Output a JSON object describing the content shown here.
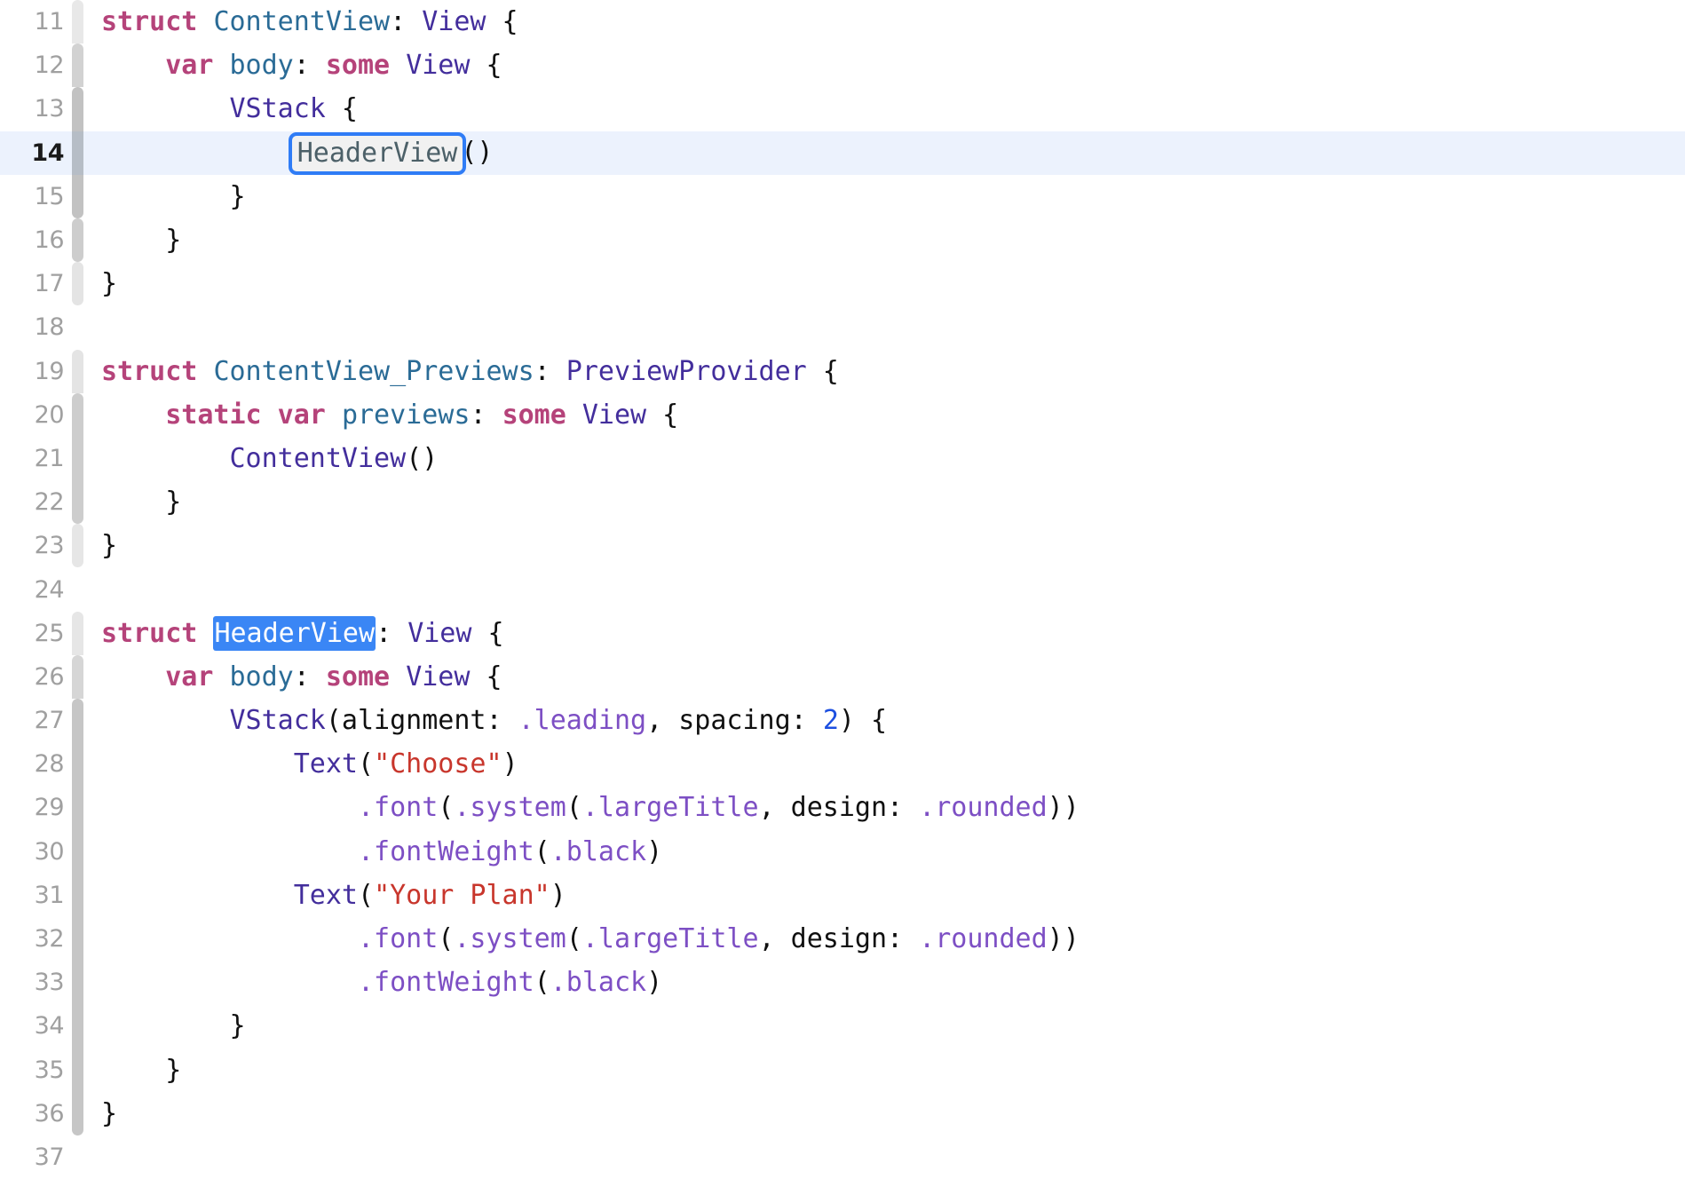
{
  "editor": {
    "name": "code-editor",
    "language": "Swift",
    "current_line": 14,
    "colors": {
      "background": "#ffffff",
      "current_line_highlight": "#ecf2fd",
      "gutter_text": "#a0a0a0",
      "gutter_text_current": "#1a1a1a",
      "keyword": "#b5437a",
      "type": "#2a6b96",
      "protocol": "#432e9c",
      "member": "#7d4fc4",
      "string": "#c8362c",
      "number": "#1c4fe0",
      "plain": "#101010",
      "selection_background": "#3a86f5",
      "selection_text": "#ffffff",
      "rename_box_border": "#2f7cf6",
      "rename_box_fill": "#f1f1f1",
      "rename_box_text": "#4c6068"
    },
    "lines": [
      {
        "number": "11",
        "changebar": "#e8e8e8",
        "shape": "top",
        "tokens": [
          {
            "t": "struct ",
            "c": "kw"
          },
          {
            "t": "ContentView",
            "c": "type"
          },
          {
            "t": ": ",
            "c": "plain"
          },
          {
            "t": "View",
            "c": "proto"
          },
          {
            "t": " {",
            "c": "plain"
          }
        ]
      },
      {
        "number": "12",
        "changebar": "#d2d2d2",
        "shape": "top",
        "tokens": [
          {
            "t": "    ",
            "c": "plain"
          },
          {
            "t": "var ",
            "c": "kw"
          },
          {
            "t": "body",
            "c": "type"
          },
          {
            "t": ": ",
            "c": "plain"
          },
          {
            "t": "some ",
            "c": "kw"
          },
          {
            "t": "View",
            "c": "proto"
          },
          {
            "t": " {",
            "c": "plain"
          }
        ]
      },
      {
        "number": "13",
        "changebar": "#c2c2c2",
        "shape": "top",
        "tokens": [
          {
            "t": "        ",
            "c": "plain"
          },
          {
            "t": "VStack",
            "c": "ctor"
          },
          {
            "t": " {",
            "c": "plain"
          }
        ]
      },
      {
        "number": "14",
        "changebar": "#b6bdc6",
        "shape": "none",
        "current": true,
        "tokens": [
          {
            "t": "            ",
            "c": "plain"
          },
          {
            "t": "HeaderView",
            "c": "rename"
          },
          {
            "t": "()",
            "c": "plain"
          }
        ]
      },
      {
        "number": "15",
        "changebar": "#c2c2c2",
        "shape": "bottom",
        "tokens": [
          {
            "t": "        }",
            "c": "plain"
          }
        ]
      },
      {
        "number": "16",
        "changebar": "#cdcdcd",
        "shape": "both",
        "tokens": [
          {
            "t": "    }",
            "c": "plain"
          }
        ]
      },
      {
        "number": "17",
        "changebar": "#e4e4e4",
        "shape": "both",
        "tokens": [
          {
            "t": "}",
            "c": "plain"
          }
        ]
      },
      {
        "number": "18",
        "changebar": "",
        "shape": "none",
        "tokens": []
      },
      {
        "number": "19",
        "changebar": "#e4e4e4",
        "shape": "top",
        "tokens": [
          {
            "t": "struct ",
            "c": "kw"
          },
          {
            "t": "ContentView_Previews",
            "c": "type"
          },
          {
            "t": ": ",
            "c": "plain"
          },
          {
            "t": "PreviewProvider",
            "c": "proto"
          },
          {
            "t": " {",
            "c": "plain"
          }
        ]
      },
      {
        "number": "20",
        "changebar": "#cdcdcd",
        "shape": "top",
        "tokens": [
          {
            "t": "    ",
            "c": "plain"
          },
          {
            "t": "static var ",
            "c": "kw"
          },
          {
            "t": "previews",
            "c": "type"
          },
          {
            "t": ": ",
            "c": "plain"
          },
          {
            "t": "some ",
            "c": "kw"
          },
          {
            "t": "View",
            "c": "proto"
          },
          {
            "t": " {",
            "c": "plain"
          }
        ]
      },
      {
        "number": "21",
        "changebar": "#cdcdcd",
        "shape": "none",
        "tokens": [
          {
            "t": "        ",
            "c": "plain"
          },
          {
            "t": "ContentView",
            "c": "ctor"
          },
          {
            "t": "()",
            "c": "plain"
          }
        ]
      },
      {
        "number": "22",
        "changebar": "#cdcdcd",
        "shape": "bottom",
        "tokens": [
          {
            "t": "    }",
            "c": "plain"
          }
        ]
      },
      {
        "number": "23",
        "changebar": "#e6e6e6",
        "shape": "both",
        "tokens": [
          {
            "t": "}",
            "c": "plain"
          }
        ]
      },
      {
        "number": "24",
        "changebar": "",
        "shape": "none",
        "tokens": []
      },
      {
        "number": "25",
        "changebar": "#e6e6e6",
        "shape": "top",
        "tokens": [
          {
            "t": "struct ",
            "c": "kw"
          },
          {
            "t": "HeaderView",
            "c": "selected"
          },
          {
            "t": ": ",
            "c": "plain"
          },
          {
            "t": "View",
            "c": "proto"
          },
          {
            "t": " {",
            "c": "plain"
          }
        ]
      },
      {
        "number": "26",
        "changebar": "#d6d6d6",
        "shape": "top",
        "tokens": [
          {
            "t": "    ",
            "c": "plain"
          },
          {
            "t": "var ",
            "c": "kw"
          },
          {
            "t": "body",
            "c": "type"
          },
          {
            "t": ": ",
            "c": "plain"
          },
          {
            "t": "some ",
            "c": "kw"
          },
          {
            "t": "View",
            "c": "proto"
          },
          {
            "t": " {",
            "c": "plain"
          }
        ]
      },
      {
        "number": "27",
        "changebar": "#c6c6c6",
        "shape": "top",
        "tokens": [
          {
            "t": "        ",
            "c": "plain"
          },
          {
            "t": "VStack",
            "c": "ctor"
          },
          {
            "t": "(alignment: ",
            "c": "plain"
          },
          {
            "t": ".leading",
            "c": "member"
          },
          {
            "t": ", spacing: ",
            "c": "plain"
          },
          {
            "t": "2",
            "c": "num"
          },
          {
            "t": ") {",
            "c": "plain"
          }
        ]
      },
      {
        "number": "28",
        "changebar": "#c6c6c6",
        "shape": "none",
        "tokens": [
          {
            "t": "            ",
            "c": "plain"
          },
          {
            "t": "Text",
            "c": "ctor"
          },
          {
            "t": "(",
            "c": "plain"
          },
          {
            "t": "\"Choose\"",
            "c": "str"
          },
          {
            "t": ")",
            "c": "plain"
          }
        ]
      },
      {
        "number": "29",
        "changebar": "#c6c6c6",
        "shape": "none",
        "tokens": [
          {
            "t": "                ",
            "c": "plain"
          },
          {
            "t": ".font",
            "c": "member"
          },
          {
            "t": "(",
            "c": "plain"
          },
          {
            "t": ".system",
            "c": "member"
          },
          {
            "t": "(",
            "c": "plain"
          },
          {
            "t": ".largeTitle",
            "c": "member"
          },
          {
            "t": ", design: ",
            "c": "plain"
          },
          {
            "t": ".rounded",
            "c": "member"
          },
          {
            "t": "))",
            "c": "plain"
          }
        ]
      },
      {
        "number": "30",
        "changebar": "#c6c6c6",
        "shape": "none",
        "tokens": [
          {
            "t": "                ",
            "c": "plain"
          },
          {
            "t": ".fontWeight",
            "c": "member"
          },
          {
            "t": "(",
            "c": "plain"
          },
          {
            "t": ".black",
            "c": "member"
          },
          {
            "t": ")",
            "c": "plain"
          }
        ]
      },
      {
        "number": "31",
        "changebar": "#c6c6c6",
        "shape": "none",
        "tokens": [
          {
            "t": "            ",
            "c": "plain"
          },
          {
            "t": "Text",
            "c": "ctor"
          },
          {
            "t": "(",
            "c": "plain"
          },
          {
            "t": "\"Your Plan\"",
            "c": "str"
          },
          {
            "t": ")",
            "c": "plain"
          }
        ]
      },
      {
        "number": "32",
        "changebar": "#c6c6c6",
        "shape": "none",
        "tokens": [
          {
            "t": "                ",
            "c": "plain"
          },
          {
            "t": ".font",
            "c": "member"
          },
          {
            "t": "(",
            "c": "plain"
          },
          {
            "t": ".system",
            "c": "member"
          },
          {
            "t": "(",
            "c": "plain"
          },
          {
            "t": ".largeTitle",
            "c": "member"
          },
          {
            "t": ", design: ",
            "c": "plain"
          },
          {
            "t": ".rounded",
            "c": "member"
          },
          {
            "t": "))",
            "c": "plain"
          }
        ]
      },
      {
        "number": "33",
        "changebar": "#c6c6c6",
        "shape": "none",
        "tokens": [
          {
            "t": "                ",
            "c": "plain"
          },
          {
            "t": ".fontWeight",
            "c": "member"
          },
          {
            "t": "(",
            "c": "plain"
          },
          {
            "t": ".black",
            "c": "member"
          },
          {
            "t": ")",
            "c": "plain"
          }
        ]
      },
      {
        "number": "34",
        "changebar": "#c6c6c6",
        "shape": "none",
        "tokens": [
          {
            "t": "        }",
            "c": "plain"
          }
        ]
      },
      {
        "number": "35",
        "changebar": "#c6c6c6",
        "shape": "none",
        "tokens": [
          {
            "t": "    }",
            "c": "plain"
          }
        ]
      },
      {
        "number": "36",
        "changebar": "#c6c6c6",
        "shape": "bottom",
        "tokens": [
          {
            "t": "}",
            "c": "plain"
          }
        ]
      },
      {
        "number": "37",
        "changebar": "",
        "shape": "none",
        "tokens": []
      }
    ]
  }
}
